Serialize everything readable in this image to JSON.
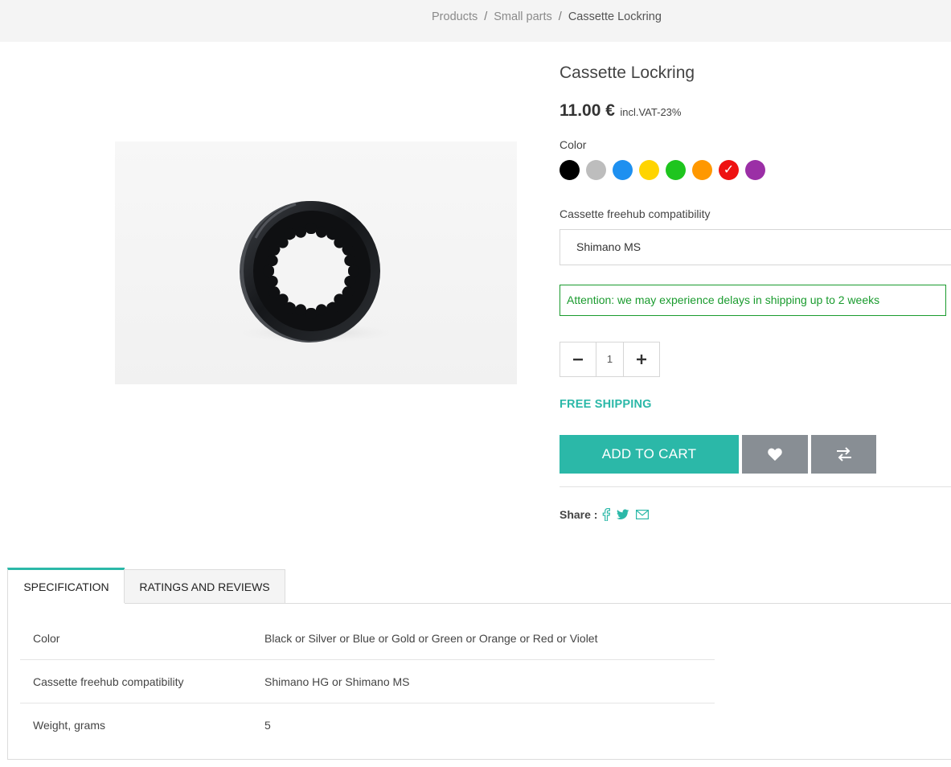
{
  "breadcrumb": {
    "items": [
      "Products",
      "Small parts"
    ],
    "separator": "/",
    "current": "Cassette Lockring"
  },
  "product": {
    "title": "Cassette Lockring",
    "price": "11.00 €",
    "vat_note": "incl.VAT-23%",
    "color_label": "Color",
    "colors": [
      {
        "name": "Black",
        "hex": "#000000",
        "selected": false
      },
      {
        "name": "Silver",
        "hex": "#bdbdbd",
        "selected": false
      },
      {
        "name": "Blue",
        "hex": "#1e90f0",
        "selected": false
      },
      {
        "name": "Gold",
        "hex": "#ffd400",
        "selected": false
      },
      {
        "name": "Green",
        "hex": "#1ec51e",
        "selected": false
      },
      {
        "name": "Orange",
        "hex": "#ff9800",
        "selected": false
      },
      {
        "name": "Red",
        "hex": "#ee1111",
        "selected": true
      },
      {
        "name": "Violet",
        "hex": "#9b2fa6",
        "selected": false
      }
    ],
    "compat_label": "Cassette freehub compatibility",
    "compat_selected": "Shimano MS",
    "alert": "Attention: we may experience delays in shipping up to 2 weeks",
    "quantity": "1",
    "free_shipping": "FREE SHIPPING",
    "add_to_cart": "ADD TO CART",
    "share_label": "Share :"
  },
  "icons": {
    "minus": "minus-icon",
    "plus": "plus-icon",
    "wishlist": "heart-icon",
    "compare": "compare-arrows-icon",
    "facebook": "facebook-icon",
    "twitter": "twitter-icon",
    "email": "envelope-icon"
  },
  "accent_color": "#2bb8a8",
  "tabs": [
    {
      "label": "SPECIFICATION",
      "active": true
    },
    {
      "label": "RATINGS AND REVIEWS",
      "active": false
    }
  ],
  "specification": [
    {
      "key": "Color",
      "value": "Black or Silver or Blue or Gold or Green or Orange or Red or Violet"
    },
    {
      "key": "Cassette freehub compatibility",
      "value": "Shimano HG or Shimano MS"
    },
    {
      "key": "Weight, grams",
      "value": "5"
    }
  ]
}
